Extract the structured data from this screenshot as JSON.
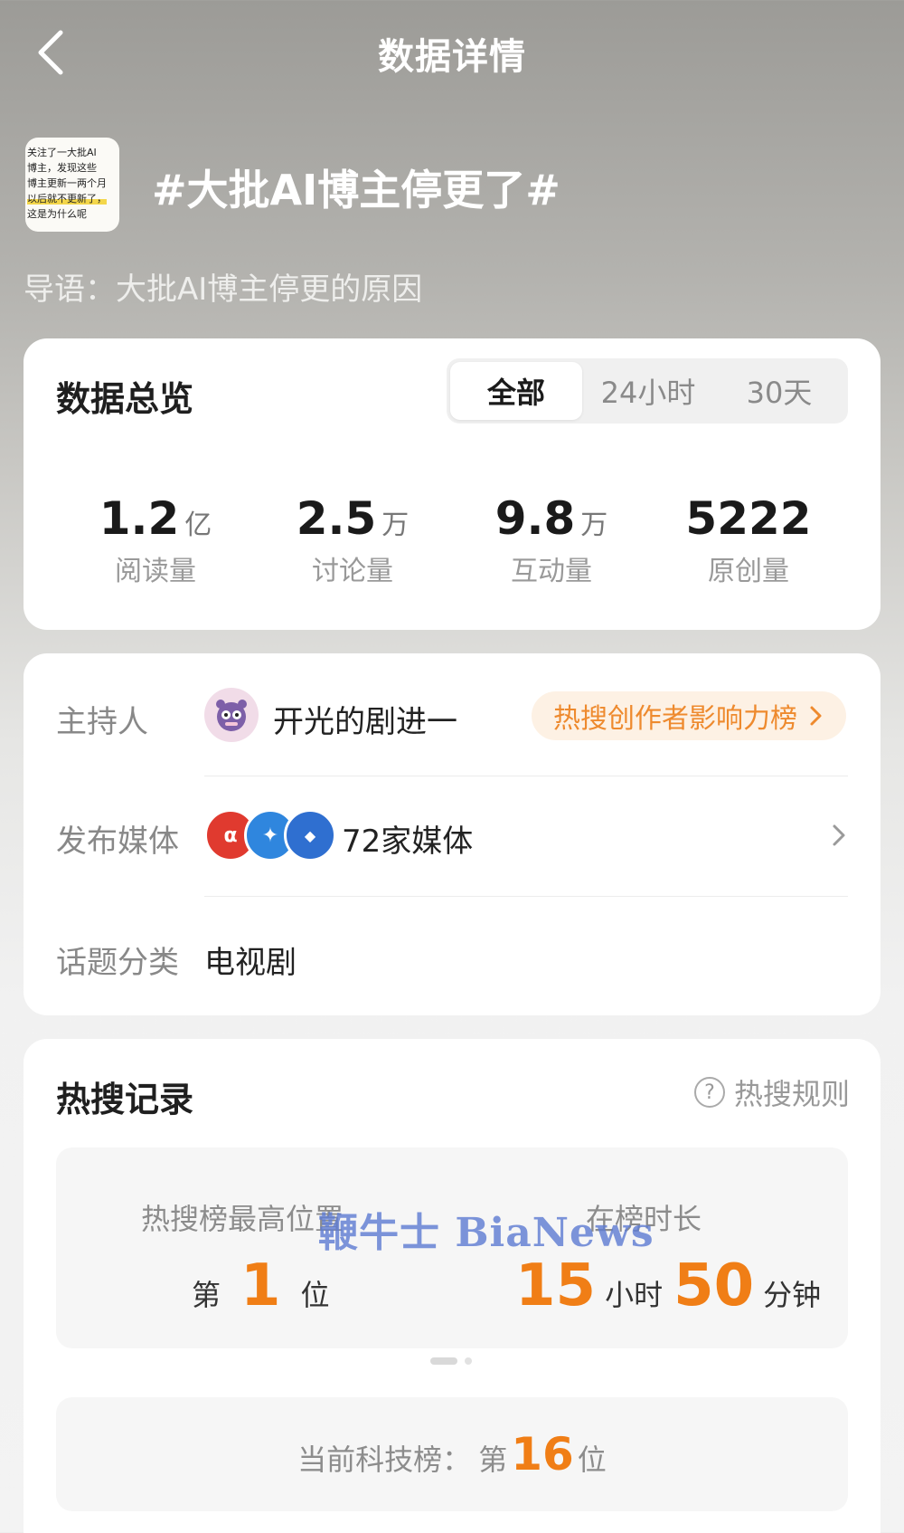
{
  "header": {
    "title": "数据详情"
  },
  "topic": {
    "title": "#大批AI博主停更了#",
    "thumbnail_lines": [
      "关注了一大批AI",
      "博主，发现这些",
      "博主更新一两个月",
      "以后就不更新了，",
      "这是为什么呢"
    ],
    "guide": "导语：大批AI博主停更的原因"
  },
  "overview": {
    "title": "数据总览",
    "tabs": [
      {
        "label": "全部",
        "active": true
      },
      {
        "label": "24小时",
        "active": false
      },
      {
        "label": "30天",
        "active": false
      }
    ],
    "stats": [
      {
        "value": "1.2",
        "unit": "亿",
        "label": "阅读量"
      },
      {
        "value": "2.5",
        "unit": "万",
        "label": "讨论量"
      },
      {
        "value": "9.8",
        "unit": "万",
        "label": "互动量"
      },
      {
        "value": "5222",
        "unit": "",
        "label": "原创量"
      }
    ]
  },
  "info": {
    "host_label": "主持人",
    "host_name": "开光的剧进一",
    "host_badge": "热搜创作者影响力榜",
    "media_label": "发布媒体",
    "media_count": "72家媒体",
    "category_label": "话题分类",
    "category_value": "电视剧"
  },
  "hot": {
    "title": "热搜记录",
    "rules": "热搜规则",
    "peak_label": "热搜榜最高位置",
    "peak_prefix": "第",
    "peak_value": "1",
    "peak_suffix": "位",
    "duration_label": "在榜时长",
    "hours": "15",
    "hours_unit": "小时",
    "minutes": "50",
    "minutes_unit": "分钟",
    "current_label": "当前科技榜：",
    "current_prefix": "第",
    "current_value": "16",
    "current_suffix": "位"
  },
  "watermark": "鞭牛士 BiaNews",
  "colors": {
    "accent_orange": "#f07e16",
    "badge_bg": "#fdf1e4",
    "watermark": "#5f7dd2"
  }
}
